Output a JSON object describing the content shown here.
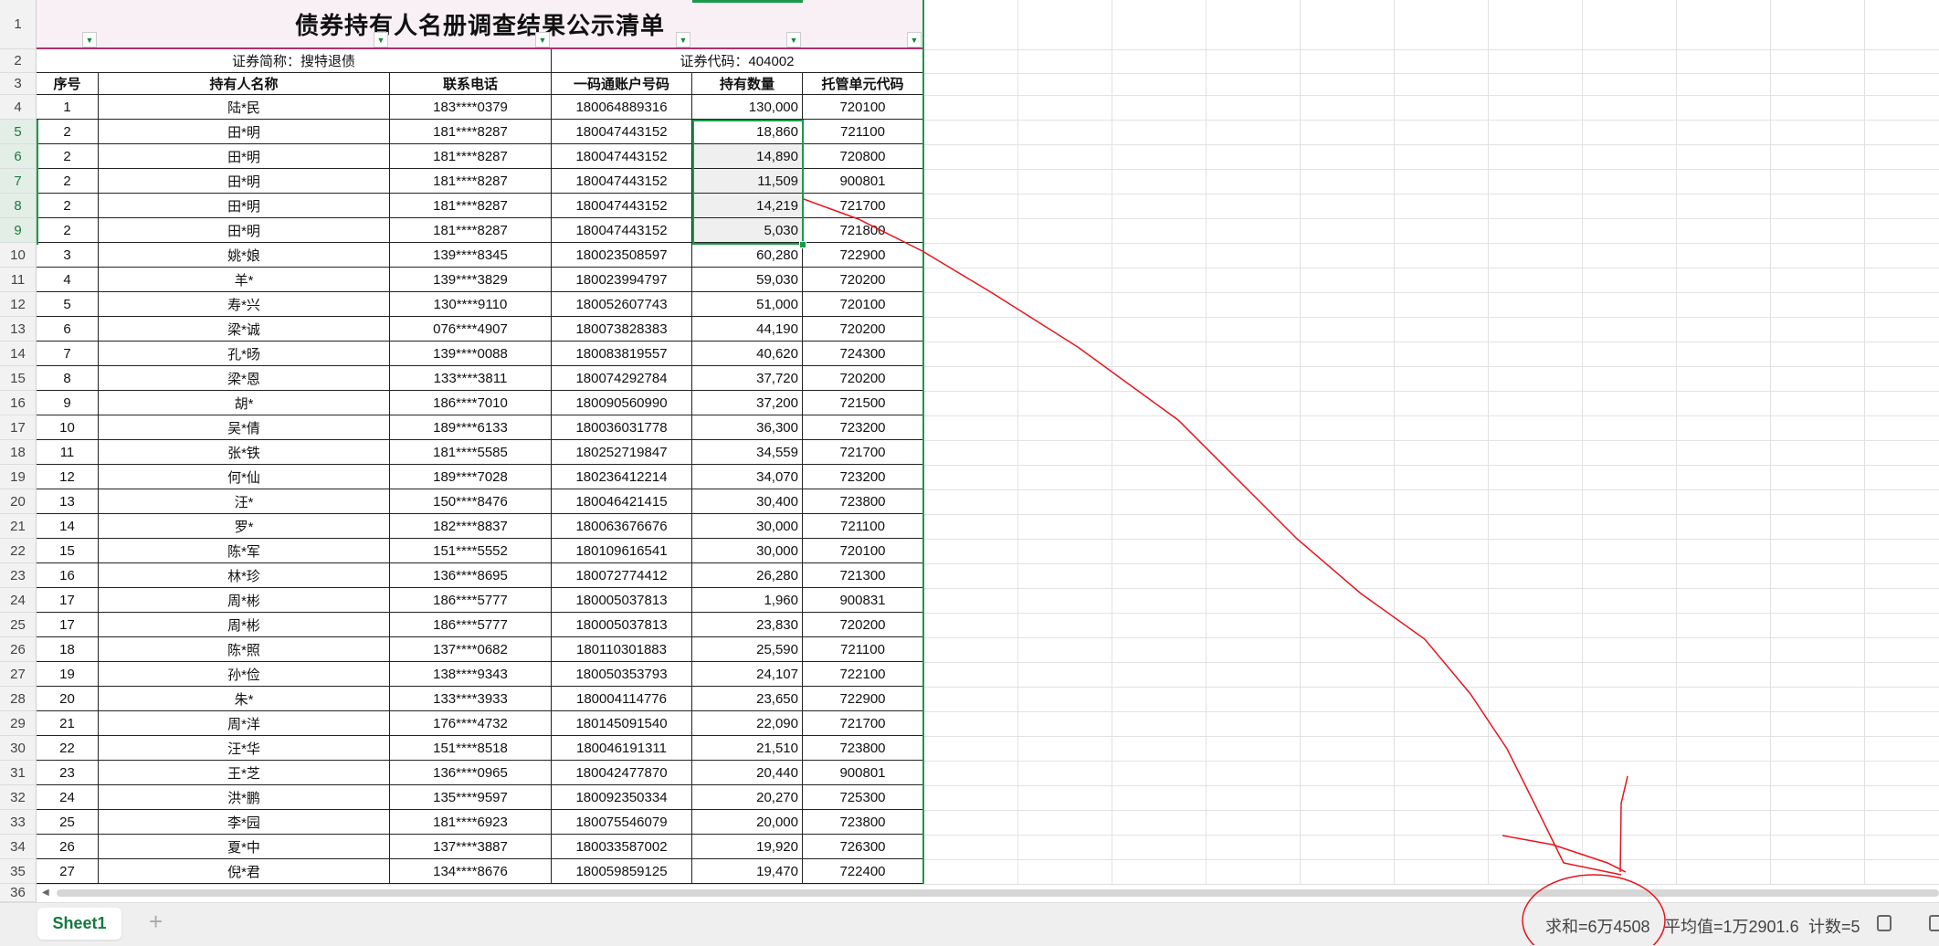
{
  "title": "债券持有人名册调查结果公示清单",
  "subheader": {
    "short_name": "证券简称：搜特退债",
    "code": "证券代码：404002"
  },
  "columns": [
    "序号",
    "持有人名称",
    "联系电话",
    "一码通账户号码",
    "持有数量",
    "托管单元代码"
  ],
  "rows": [
    [
      "1",
      "陆*民",
      "183****0379",
      "180064889316",
      "130,000",
      "720100"
    ],
    [
      "2",
      "田*明",
      "181****8287",
      "180047443152",
      "18,860",
      "721100"
    ],
    [
      "2",
      "田*明",
      "181****8287",
      "180047443152",
      "14,890",
      "720800"
    ],
    [
      "2",
      "田*明",
      "181****8287",
      "180047443152",
      "11,509",
      "900801"
    ],
    [
      "2",
      "田*明",
      "181****8287",
      "180047443152",
      "14,219",
      "721700"
    ],
    [
      "2",
      "田*明",
      "181****8287",
      "180047443152",
      "5,030",
      "721800"
    ],
    [
      "3",
      "姚*娘",
      "139****8345",
      "180023508597",
      "60,280",
      "722900"
    ],
    [
      "4",
      "羊*",
      "139****3829",
      "180023994797",
      "59,030",
      "720200"
    ],
    [
      "5",
      "寿*兴",
      "130****9110",
      "180052607743",
      "51,000",
      "720100"
    ],
    [
      "6",
      "梁*诚",
      "076****4907",
      "180073828383",
      "44,190",
      "720200"
    ],
    [
      "7",
      "孔*旸",
      "139****0088",
      "180083819557",
      "40,620",
      "724300"
    ],
    [
      "8",
      "梁*恩",
      "133****3811",
      "180074292784",
      "37,720",
      "720200"
    ],
    [
      "9",
      "胡*",
      "186****7010",
      "180090560990",
      "37,200",
      "721500"
    ],
    [
      "10",
      "吴*倩",
      "189****6133",
      "180036031778",
      "36,300",
      "723200"
    ],
    [
      "11",
      "张*铁",
      "181****5585",
      "180252719847",
      "34,559",
      "721700"
    ],
    [
      "12",
      "何*仙",
      "189****7028",
      "180236412214",
      "34,070",
      "723200"
    ],
    [
      "13",
      "汪*",
      "150****8476",
      "180046421415",
      "30,400",
      "723800"
    ],
    [
      "14",
      "罗*",
      "182****8837",
      "180063676676",
      "30,000",
      "721100"
    ],
    [
      "15",
      "陈*军",
      "151****5552",
      "180109616541",
      "30,000",
      "720100"
    ],
    [
      "16",
      "林*珍",
      "136****8695",
      "180072774412",
      "26,280",
      "721300"
    ],
    [
      "17",
      "周*彬",
      "186****5777",
      "180005037813",
      "1,960",
      "900831"
    ],
    [
      "17",
      "周*彬",
      "186****5777",
      "180005037813",
      "23,830",
      "720200"
    ],
    [
      "18",
      "陈*照",
      "137****0682",
      "180110301883",
      "25,590",
      "721100"
    ],
    [
      "19",
      "孙*俭",
      "138****9343",
      "180050353793",
      "24,107",
      "722100"
    ],
    [
      "20",
      "朱*",
      "133****3933",
      "180004114776",
      "23,650",
      "722900"
    ],
    [
      "21",
      "周*洋",
      "176****4732",
      "180145091540",
      "22,090",
      "721700"
    ],
    [
      "22",
      "汪*华",
      "151****8518",
      "180046191311",
      "21,510",
      "723800"
    ],
    [
      "23",
      "王*芝",
      "136****0965",
      "180042477870",
      "20,440",
      "900801"
    ],
    [
      "24",
      "洪*鹏",
      "135****9597",
      "180092350334",
      "20,270",
      "725300"
    ],
    [
      "25",
      "李*园",
      "181****6923",
      "180075546079",
      "20,000",
      "723800"
    ],
    [
      "26",
      "夏*中",
      "137****3887",
      "180033587002",
      "19,920",
      "726300"
    ],
    [
      "27",
      "倪*君",
      "134****8676",
      "180059859125",
      "19,470",
      "722400"
    ]
  ],
  "row_numbers": [
    "1",
    "2",
    "3",
    "4",
    "5",
    "6",
    "7",
    "8",
    "9",
    "10",
    "11",
    "12",
    "13",
    "14",
    "15",
    "16",
    "17",
    "18",
    "19",
    "20",
    "21",
    "22",
    "23",
    "24",
    "25",
    "26",
    "27",
    "28",
    "29",
    "30",
    "31",
    "32",
    "33",
    "34",
    "35",
    "36"
  ],
  "sheet_tab": "Sheet1",
  "add_sheet": "+",
  "status": {
    "sum": "求和=6万4508",
    "average": "平均值=1万2901.6",
    "count": "计数=5"
  },
  "colors": {
    "accent": "#1a9a4a",
    "title_bg": "#f9f0f6",
    "title_border": "#b03070",
    "annotation": "#e8141c"
  }
}
